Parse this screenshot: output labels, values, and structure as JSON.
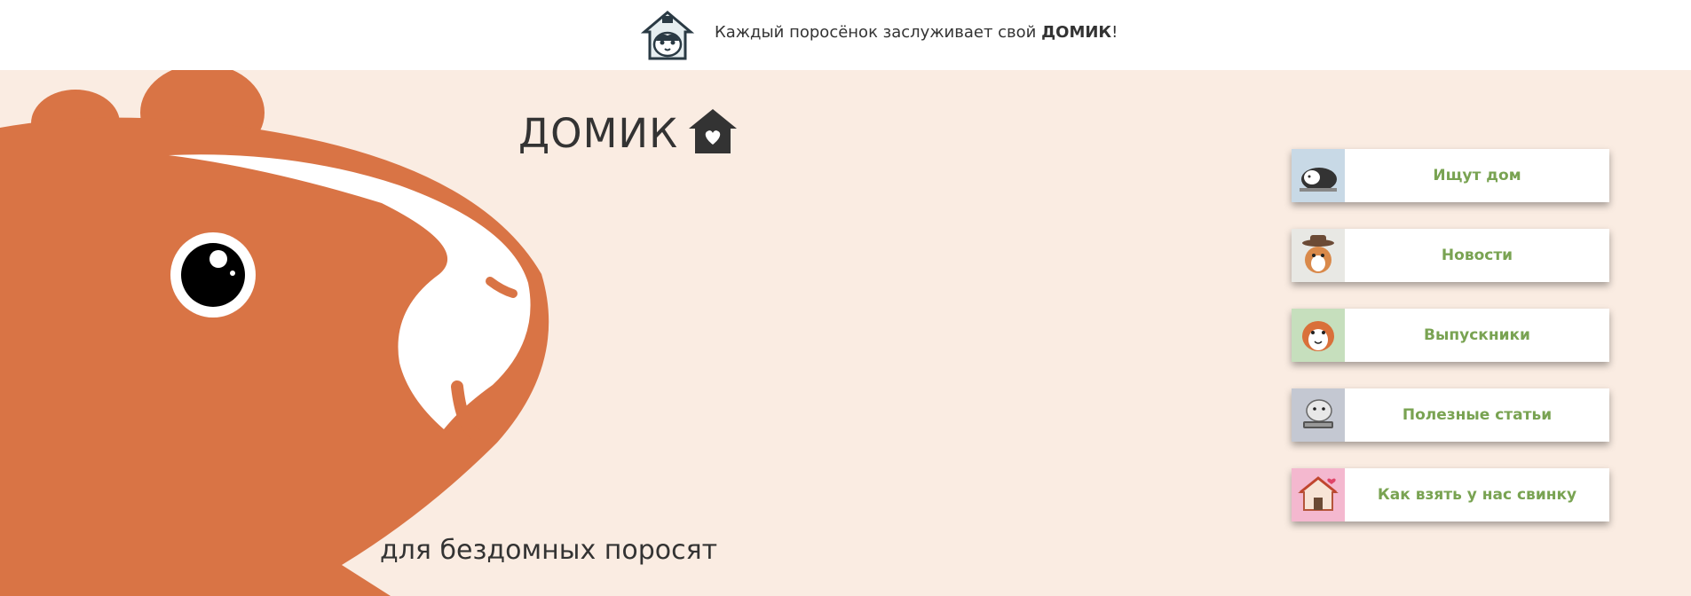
{
  "header": {
    "logo_icon": "guinea-pig-house-logo",
    "tagline_prefix": "Каждый поросёнок заслуживает свой ",
    "tagline_strong": "ДОМИК",
    "tagline_suffix": "!"
  },
  "hero": {
    "brand_title": "ДОМИК",
    "brand_icon": "house-heart-icon",
    "subtitle": "для бездомных поросят",
    "colors": {
      "background": "#faece2",
      "pig": "#d97445",
      "accent": "#79a352"
    }
  },
  "nav": {
    "items": [
      {
        "label": "Ищут дом",
        "icon": "sleeping-guinea-pig-icon",
        "thumb_bg": "#c8d9e6"
      },
      {
        "label": "Новости",
        "icon": "guinea-pig-with-hat-icon",
        "thumb_bg": "#e8e8e4"
      },
      {
        "label": "Выпускники",
        "icon": "happy-guinea-pig-icon",
        "thumb_bg": "#c6dfbd"
      },
      {
        "label": "Полезные статьи",
        "icon": "guinea-pig-laptop-icon",
        "thumb_bg": "#c4c8d2"
      },
      {
        "label": "Как взять у нас свинку",
        "icon": "guinea-pig-house-icon",
        "thumb_bg": "#f4b8cf"
      }
    ]
  }
}
